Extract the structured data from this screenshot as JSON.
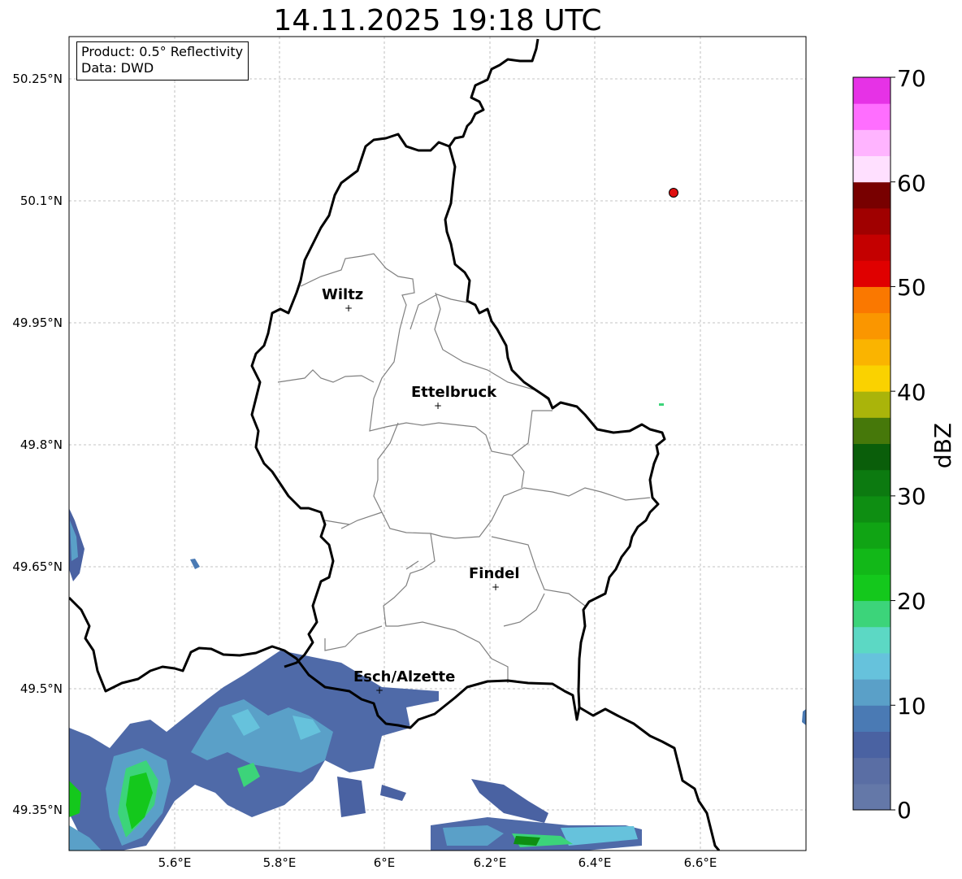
{
  "title": "14.11.2025 19:18 UTC",
  "info_box": {
    "line1": "Product: 0.5° Reflectivity",
    "line2": "Data: DWD"
  },
  "axes": {
    "lon_ticks": [
      "5.6°E",
      "5.8°E",
      "6°E",
      "6.2°E",
      "6.4°E",
      "6.6°E"
    ],
    "lat_ticks": [
      "50.25°N",
      "50.1°N",
      "49.95°N",
      "49.8°N",
      "49.65°N",
      "49.5°N",
      "49.35°N"
    ]
  },
  "cities": [
    {
      "name": "Wiltz"
    },
    {
      "name": "Ettelbruck"
    },
    {
      "name": "Findel"
    },
    {
      "name": "Esch/Alzette"
    }
  ],
  "colorbar": {
    "label": "dBZ",
    "ticks": [
      "0",
      "10",
      "20",
      "30",
      "40",
      "50",
      "60",
      "70"
    ],
    "colors": [
      "#6478a8",
      "#5a6ea4",
      "#4a62a2",
      "#4a7ab4",
      "#5aa0c8",
      "#66c2dc",
      "#5cd8c4",
      "#3cd47a",
      "#14c81c",
      "#12b818",
      "#10a414",
      "#0e8e12",
      "#0c7a10",
      "#0a5e0a",
      "#46780a",
      "#aab40a",
      "#fad200",
      "#fab400",
      "#fa9600",
      "#fa7800",
      "#e00000",
      "#c40000",
      "#a00000",
      "#780000",
      "#ffe0ff",
      "#ffb4ff",
      "#ff6eff",
      "#e632e6"
    ]
  },
  "radar_marker": {
    "color": "#e01010"
  }
}
